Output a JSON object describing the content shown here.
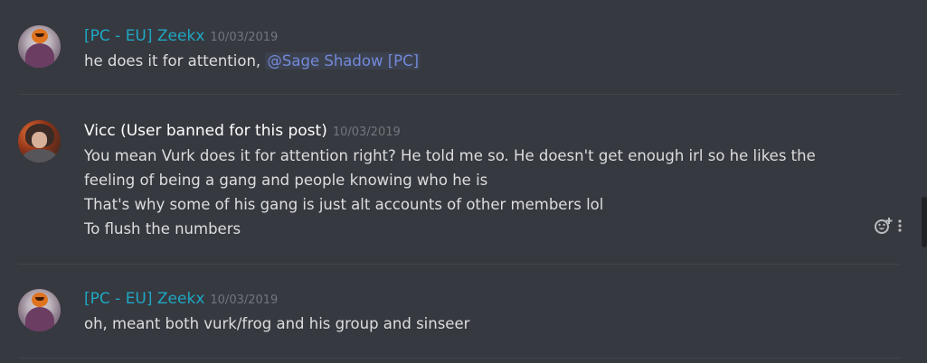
{
  "messages": [
    {
      "username": "[PC - EU] Zeekx",
      "timestamp": "10/03/2019",
      "text_before": "he does it for attention, ",
      "mention": "@Sage Shadow [PC]",
      "name_color": "#1fa7c4"
    },
    {
      "username": "Vicc (User banned for this post)",
      "timestamp": "10/03/2019",
      "lines": [
        "You mean Vurk does it for attention right? He told me so. He doesn't get enough irl so he likes the",
        "feeling of being a gang and people knowing who he is",
        "That's why some of his gang is just alt accounts of other members lol",
        "To flush the numbers"
      ],
      "name_color": "#ffffff"
    },
    {
      "username": "[PC - EU] Zeekx",
      "timestamp": "10/03/2019",
      "text": "oh, meant both vurk/frog and his group and sinseer",
      "name_color": "#1fa7c4"
    }
  ],
  "actions": {
    "add_reaction_icon": "emoji-add-icon",
    "more_icon": "more-vertical-icon"
  },
  "colors": {
    "background": "#36393f",
    "divider": "#42454a",
    "mention": "#7289da"
  }
}
